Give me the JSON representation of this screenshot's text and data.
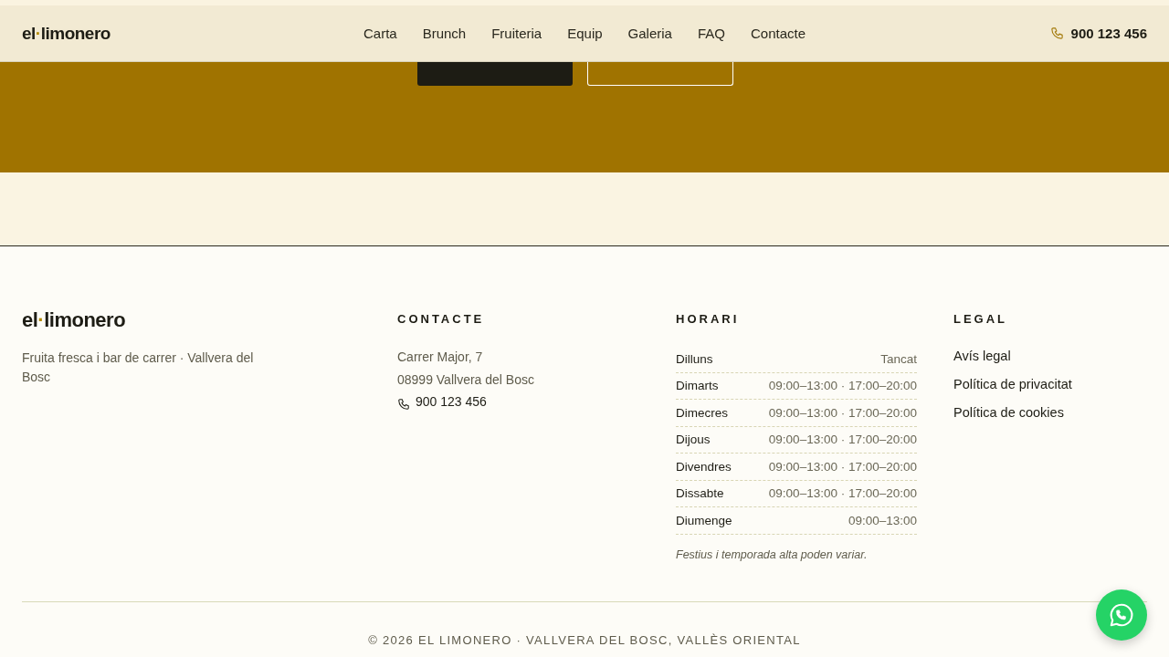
{
  "header": {
    "logo": [
      "el",
      "·",
      "limonero"
    ],
    "nav": [
      {
        "label": "Carta"
      },
      {
        "label": "Brunch"
      },
      {
        "label": "Fruiteria"
      },
      {
        "label": "Equip"
      },
      {
        "label": "Galeria"
      },
      {
        "label": "FAQ"
      },
      {
        "label": "Contacte"
      }
    ],
    "phone": "900 123 456"
  },
  "hero": {
    "buttons": [
      {
        "kind": "solid"
      },
      {
        "kind": "outline"
      }
    ]
  },
  "footer": {
    "logo": [
      "el",
      "·",
      "limonero"
    ],
    "tagline": "Fruita fresca i bar de carrer · Vallvera del Bosc",
    "contact": {
      "title": "CONTACTE",
      "lines": [
        "Carrer Major, 7",
        "08999 Vallvera del Bosc"
      ],
      "phone": "900 123 456"
    },
    "hours": {
      "title": "HORARI",
      "rows": [
        {
          "day": "Dilluns",
          "time": "Tancat"
        },
        {
          "day": "Dimarts",
          "time": "09:00–13:00 · 17:00–20:00"
        },
        {
          "day": "Dimecres",
          "time": "09:00–13:00 · 17:00–20:00"
        },
        {
          "day": "Dijous",
          "time": "09:00–13:00 · 17:00–20:00"
        },
        {
          "day": "Divendres",
          "time": "09:00–13:00 · 17:00–20:00"
        },
        {
          "day": "Dissabte",
          "time": "09:00–13:00 · 17:00–20:00"
        },
        {
          "day": "Diumenge",
          "time": "09:00–13:00"
        }
      ],
      "note": "Festius i temporada alta poden variar."
    },
    "legal": {
      "title": "LEGAL",
      "links": [
        "Avís legal",
        "Política de privacitat",
        "Política de cookies"
      ]
    },
    "copyright": "© 2026 EL LIMONERO · VALLVERA DEL BOSC, VALLÈS ORIENTAL"
  }
}
